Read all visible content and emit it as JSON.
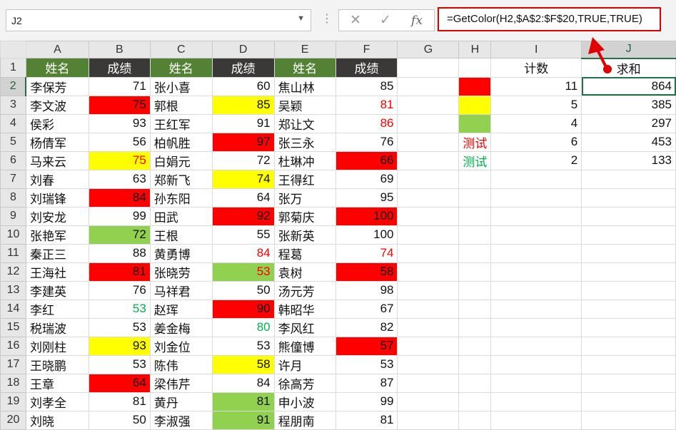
{
  "name_box": {
    "value": "J2"
  },
  "formula_bar": {
    "formula": "=GetColor(H2,$A$2:$F$20,TRUE,TRUE)",
    "cancel_glyph": "✕",
    "enter_glyph": "✓",
    "fx_glyph": "fx"
  },
  "columns": [
    "A",
    "B",
    "C",
    "D",
    "E",
    "F",
    "G",
    "H",
    "I",
    "J"
  ],
  "selected_cell": "J2",
  "header_row": {
    "row": "1",
    "A": "姓名",
    "B": "成绩",
    "C": "姓名",
    "D": "成绩",
    "E": "姓名",
    "F": "成绩",
    "I": "计数",
    "J": "求和"
  },
  "rows": [
    {
      "row": "2",
      "A": "李保芳",
      "B": "71",
      "C": "张小喜",
      "D": "60",
      "E": "焦山林",
      "F": "85",
      "I": "11",
      "J": "864"
    },
    {
      "row": "3",
      "A": "李文波",
      "B": "75",
      "C": "郭根",
      "D": "85",
      "E": "吴颖",
      "F": "81",
      "I": "5",
      "J": "385"
    },
    {
      "row": "4",
      "A": "侯彩",
      "B": "93",
      "C": "王红军",
      "D": "91",
      "E": "郑让文",
      "F": "86",
      "I": "4",
      "J": "297"
    },
    {
      "row": "5",
      "A": "杨倩军",
      "B": "56",
      "C": "柏帆胜",
      "D": "97",
      "E": "张三永",
      "F": "76",
      "H": "测试",
      "I": "6",
      "J": "453"
    },
    {
      "row": "6",
      "A": "马来云",
      "B": "75",
      "C": "白娟元",
      "D": "72",
      "E": "杜琳冲",
      "F": "66",
      "H": "测试",
      "I": "2",
      "J": "133"
    },
    {
      "row": "7",
      "A": "刘春",
      "B": "63",
      "C": "郑新飞",
      "D": "74",
      "E": "王得红",
      "F": "69"
    },
    {
      "row": "8",
      "A": "刘瑞锋",
      "B": "84",
      "C": "孙东阳",
      "D": "64",
      "E": "张万",
      "F": "95"
    },
    {
      "row": "9",
      "A": "刘安龙",
      "B": "99",
      "C": "田武",
      "D": "92",
      "E": "郭菊庆",
      "F": "100"
    },
    {
      "row": "10",
      "A": "张艳军",
      "B": "72",
      "C": "王根",
      "D": "55",
      "E": "张新英",
      "F": "100"
    },
    {
      "row": "11",
      "A": "秦正三",
      "B": "88",
      "C": "黄勇博",
      "D": "84",
      "E": "程葛",
      "F": "74"
    },
    {
      "row": "12",
      "A": "王海社",
      "B": "81",
      "C": "张晓劳",
      "D": "53",
      "E": "袁树",
      "F": "58"
    },
    {
      "row": "13",
      "A": "李建英",
      "B": "76",
      "C": "马祥君",
      "D": "50",
      "E": "汤元芳",
      "F": "98"
    },
    {
      "row": "14",
      "A": "李红",
      "B": "53",
      "C": "赵珲",
      "D": "90",
      "E": "韩昭华",
      "F": "67"
    },
    {
      "row": "15",
      "A": "税瑞波",
      "B": "53",
      "C": "姜金梅",
      "D": "80",
      "E": "李风红",
      "F": "82"
    },
    {
      "row": "16",
      "A": "刘刚柱",
      "B": "93",
      "C": "刘金位",
      "D": "53",
      "E": "熊僮博",
      "F": "57"
    },
    {
      "row": "17",
      "A": "王晓鹏",
      "B": "53",
      "C": "陈伟",
      "D": "58",
      "E": "许月",
      "F": "53"
    },
    {
      "row": "18",
      "A": "王章",
      "B": "64",
      "C": "梁伟芹",
      "D": "84",
      "E": "徐高芳",
      "F": "87"
    },
    {
      "row": "19",
      "A": "刘孝全",
      "B": "81",
      "C": "黄丹",
      "D": "81",
      "E": "申小波",
      "F": "99"
    },
    {
      "row": "20",
      "A": "刘晓",
      "B": "50",
      "C": "李淑强",
      "D": "91",
      "E": "程朋南",
      "F": "81"
    }
  ],
  "fill_colors": {
    "red": "#ff0000",
    "yellow": "#ffff00",
    "green": "#92d050",
    "name_header": "#548235",
    "score_header": "#3b3838"
  },
  "font_colors": {
    "red": "#ff0000",
    "green": "#00b050"
  },
  "cell_fill": {
    "B3": "red",
    "B6": "yellow",
    "B8": "red",
    "B10": "green",
    "B12": "red",
    "B16": "yellow",
    "B18": "red",
    "D3": "yellow",
    "D5": "red",
    "D7": "yellow",
    "D9": "red",
    "D12": "green",
    "D14": "red",
    "D17": "yellow",
    "D19": "green",
    "D20": "green",
    "F6": "red",
    "F9": "red",
    "F12": "red",
    "F16": "red",
    "H2": "red",
    "H3": "yellow",
    "H4": "green"
  },
  "cell_font": {
    "B6": "red",
    "B14": "green",
    "D11": "red",
    "D12": "red",
    "D15": "green",
    "F3": "red",
    "F4": "red",
    "F11": "red",
    "H5": "red",
    "H6": "green"
  },
  "annotation": {
    "arrow_color": "#e00000"
  }
}
